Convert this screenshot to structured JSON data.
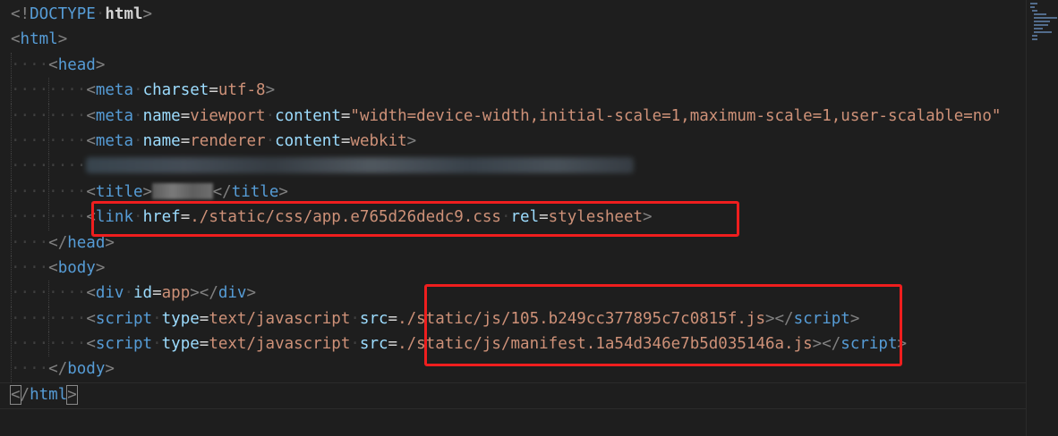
{
  "editor": {
    "lines": [
      {
        "indent": 0,
        "tokens": [
          {
            "t": "punc",
            "v": "<!"
          },
          {
            "t": "tag",
            "v": "DOCTYPE"
          },
          {
            "t": "ws",
            "v": "·"
          },
          {
            "t": "kw",
            "v": "html"
          },
          {
            "t": "punc",
            "v": ">"
          }
        ]
      },
      {
        "indent": 0,
        "tokens": [
          {
            "t": "punc",
            "v": "<"
          },
          {
            "t": "tag",
            "v": "html"
          },
          {
            "t": "punc",
            "v": ">"
          }
        ]
      },
      {
        "indent": 1,
        "tokens": [
          {
            "t": "punc",
            "v": "<"
          },
          {
            "t": "tag",
            "v": "head"
          },
          {
            "t": "punc",
            "v": ">"
          }
        ]
      },
      {
        "indent": 2,
        "tokens": [
          {
            "t": "punc",
            "v": "<"
          },
          {
            "t": "tag",
            "v": "meta"
          },
          {
            "t": "ws",
            "v": "·"
          },
          {
            "t": "attr",
            "v": "charset"
          },
          {
            "t": "text",
            "v": "="
          },
          {
            "t": "val",
            "v": "utf-8"
          },
          {
            "t": "punc",
            "v": ">"
          }
        ]
      },
      {
        "indent": 2,
        "tokens": [
          {
            "t": "punc",
            "v": "<"
          },
          {
            "t": "tag",
            "v": "meta"
          },
          {
            "t": "ws",
            "v": "·"
          },
          {
            "t": "attr",
            "v": "name"
          },
          {
            "t": "text",
            "v": "="
          },
          {
            "t": "val",
            "v": "viewport"
          },
          {
            "t": "ws",
            "v": "·"
          },
          {
            "t": "attr",
            "v": "content"
          },
          {
            "t": "text",
            "v": "="
          },
          {
            "t": "val",
            "v": "\"width=device-width,initial-scale=1,maximum-scale=1,user-scalable=no\""
          }
        ]
      },
      {
        "indent": 2,
        "tokens": [
          {
            "t": "punc",
            "v": "<"
          },
          {
            "t": "tag",
            "v": "meta"
          },
          {
            "t": "ws",
            "v": "·"
          },
          {
            "t": "attr",
            "v": "name"
          },
          {
            "t": "text",
            "v": "="
          },
          {
            "t": "val",
            "v": "renderer"
          },
          {
            "t": "ws",
            "v": "·"
          },
          {
            "t": "attr",
            "v": "content"
          },
          {
            "t": "text",
            "v": "="
          },
          {
            "t": "val",
            "v": "webkit"
          },
          {
            "t": "punc",
            "v": ">"
          }
        ]
      },
      {
        "indent": 2,
        "tokens": [
          {
            "t": "blur",
            "chars": 58
          }
        ]
      },
      {
        "indent": 2,
        "tokens": [
          {
            "t": "punc",
            "v": "<"
          },
          {
            "t": "tag",
            "v": "title"
          },
          {
            "t": "punc",
            "v": ">"
          },
          {
            "t": "blurtitle",
            "chars": 4
          },
          {
            "t": "punc",
            "v": "</"
          },
          {
            "t": "tag",
            "v": "title"
          },
          {
            "t": "punc",
            "v": ">"
          }
        ]
      },
      {
        "indent": 2,
        "tokens": [
          {
            "t": "punc",
            "v": "<"
          },
          {
            "t": "tag",
            "v": "link"
          },
          {
            "t": "ws",
            "v": "·"
          },
          {
            "t": "attr",
            "v": "href"
          },
          {
            "t": "text",
            "v": "="
          },
          {
            "t": "val",
            "v": "./static/css/app.e765d26dedc9.css"
          },
          {
            "t": "ws",
            "v": "·"
          },
          {
            "t": "attr",
            "v": "rel"
          },
          {
            "t": "text",
            "v": "="
          },
          {
            "t": "val",
            "v": "stylesheet"
          },
          {
            "t": "punc",
            "v": ">"
          }
        ]
      },
      {
        "indent": 1,
        "tokens": [
          {
            "t": "punc",
            "v": "</"
          },
          {
            "t": "tag",
            "v": "head"
          },
          {
            "t": "punc",
            "v": ">"
          }
        ]
      },
      {
        "indent": 1,
        "tokens": [
          {
            "t": "punc",
            "v": "<"
          },
          {
            "t": "tag",
            "v": "body"
          },
          {
            "t": "punc",
            "v": ">"
          }
        ]
      },
      {
        "indent": 2,
        "tokens": [
          {
            "t": "punc",
            "v": "<"
          },
          {
            "t": "tag",
            "v": "div"
          },
          {
            "t": "ws",
            "v": "·"
          },
          {
            "t": "attr",
            "v": "id"
          },
          {
            "t": "text",
            "v": "="
          },
          {
            "t": "val",
            "v": "app"
          },
          {
            "t": "punc",
            "v": "></"
          },
          {
            "t": "tag",
            "v": "div"
          },
          {
            "t": "punc",
            "v": ">"
          }
        ]
      },
      {
        "indent": 2,
        "tokens": [
          {
            "t": "punc",
            "v": "<"
          },
          {
            "t": "tag",
            "v": "script"
          },
          {
            "t": "ws",
            "v": "·"
          },
          {
            "t": "attr",
            "v": "type"
          },
          {
            "t": "text",
            "v": "="
          },
          {
            "t": "val",
            "v": "text/javascript"
          },
          {
            "t": "ws",
            "v": "·"
          },
          {
            "t": "attr",
            "v": "src"
          },
          {
            "t": "text",
            "v": "="
          },
          {
            "t": "val",
            "v": "./static/js/105.b249cc377895c7c0815f.js"
          },
          {
            "t": "punc",
            "v": "></"
          },
          {
            "t": "tag",
            "v": "script"
          },
          {
            "t": "punc",
            "v": ">"
          }
        ]
      },
      {
        "indent": 2,
        "tokens": [
          {
            "t": "punc",
            "v": "<"
          },
          {
            "t": "tag",
            "v": "script"
          },
          {
            "t": "ws",
            "v": "·"
          },
          {
            "t": "attr",
            "v": "type"
          },
          {
            "t": "text",
            "v": "="
          },
          {
            "t": "val",
            "v": "text/javascript"
          },
          {
            "t": "ws",
            "v": "·"
          },
          {
            "t": "attr",
            "v": "src"
          },
          {
            "t": "text",
            "v": "="
          },
          {
            "t": "val",
            "v": "./static/js/manifest.1a54d346e7b5d035146a.js"
          },
          {
            "t": "punc",
            "v": "></"
          },
          {
            "t": "tag",
            "v": "script"
          },
          {
            "t": "punc",
            "v": ">"
          }
        ]
      },
      {
        "indent": 1,
        "tokens": [
          {
            "t": "punc",
            "v": "</"
          },
          {
            "t": "tag",
            "v": "body"
          },
          {
            "t": "punc",
            "v": ">"
          }
        ]
      },
      {
        "indent": 0,
        "tokens": [
          {
            "t": "punc",
            "v": "<",
            "box": true
          },
          {
            "t": "punc",
            "v": "/"
          },
          {
            "t": "tag",
            "v": "html"
          },
          {
            "t": "punc",
            "v": ">",
            "box": true
          }
        ]
      }
    ]
  },
  "colors": {
    "background": "#1e1e1e",
    "tag": "#569cd6",
    "attribute": "#9cdcfe",
    "value": "#ce9178",
    "punctuation": "#808080",
    "highlight": "#ef1e1e"
  }
}
